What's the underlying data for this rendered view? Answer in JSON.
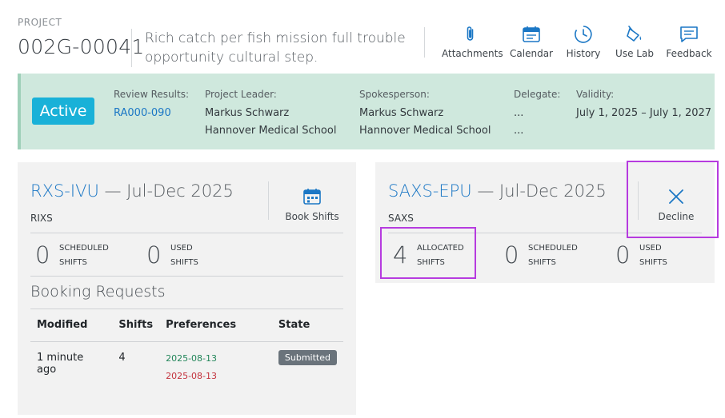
{
  "project": {
    "label": "PROJECT",
    "id": "002G-00041",
    "description": "Rich catch per fish mission full trouble opportunity cultural step."
  },
  "toolbar": {
    "attachments": "Attachments",
    "calendar": "Calendar",
    "history": "History",
    "use_lab": "Use Lab",
    "feedback": "Feedback"
  },
  "banner": {
    "status": "Active",
    "review_label": "Review Results:",
    "review_value": "RA000-090",
    "leader_label": "Project Leader:",
    "leader_name": "Markus Schwarz",
    "leader_org": "Hannover Medical School",
    "spokes_label": "Spokesperson:",
    "spokes_name": "Markus Schwarz",
    "spokes_org": "Hannover Medical School",
    "delegate_label": "Delegate:",
    "delegate_line1": "...",
    "delegate_line2": "...",
    "validity_label": "Validity:",
    "validity_value": "July 1, 2025 – July 1, 2027"
  },
  "card1": {
    "code": "RXS-IVU",
    "period": " — Jul-Dec 2025",
    "subtitle": "RIXS",
    "button_label": "Book Shifts",
    "stats": [
      {
        "value": "0",
        "line1": "SCHEDULED",
        "line2": "SHIFTS"
      },
      {
        "value": "0",
        "line1": "USED",
        "line2": "SHIFTS"
      }
    ],
    "requests_title": "Booking Requests",
    "columns": [
      "Modified",
      "Shifts",
      "Preferences",
      "State"
    ],
    "rows": [
      {
        "modified": "1 minute ago",
        "shifts": "4",
        "pref1": "2025-08-13",
        "pref2": "2025-08-13",
        "state": "Submitted"
      }
    ]
  },
  "card2": {
    "code": "SAXS-EPU",
    "period": " — Jul-Dec 2025",
    "subtitle": "SAXS",
    "button_label": "Decline",
    "stats": [
      {
        "value": "4",
        "line1": "ALLOCATED",
        "line2": "SHIFTS"
      },
      {
        "value": "0",
        "line1": "SCHEDULED",
        "line2": "SHIFTS"
      },
      {
        "value": "0",
        "line1": "USED",
        "line2": "SHIFTS"
      }
    ]
  },
  "colors": {
    "accent_blue": "#1b77c5",
    "active_badge": "#19b1d8",
    "banner_bg": "#cfe8dd",
    "highlight": "#b63bdf",
    "date_green": "#23865a",
    "date_red": "#c3323d"
  }
}
